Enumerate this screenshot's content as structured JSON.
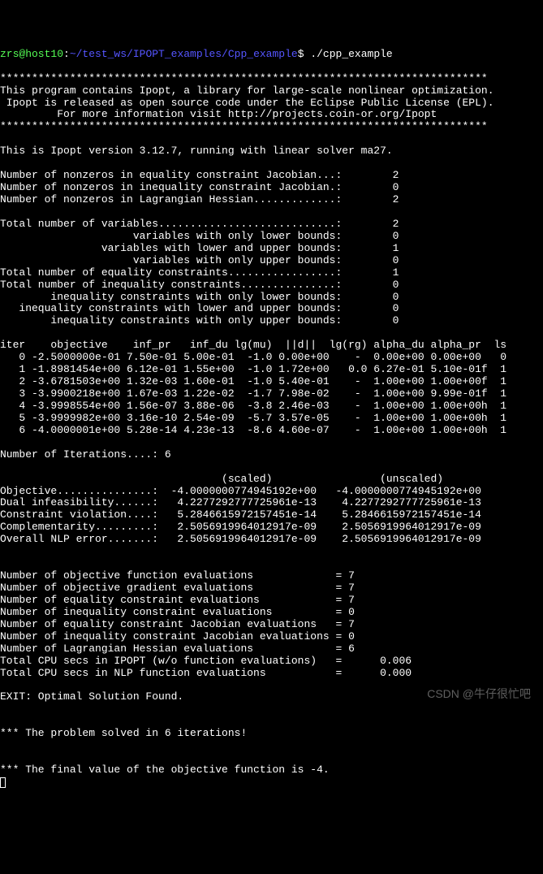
{
  "prompt": {
    "user": "zrs@host10",
    "path": "~/test_ws/IPOPT_examples/Cpp_example",
    "dollar": "$",
    "command": "./cpp_example"
  },
  "header": {
    "stars1": "*****************************************************************************",
    "line1": "This program contains Ipopt, a library for large-scale nonlinear optimization.",
    "line2": " Ipopt is released as open source code under the Eclipse Public License (EPL).",
    "line3": "         For more information visit http://projects.coin-or.org/Ipopt",
    "stars2": "*****************************************************************************"
  },
  "version": "This is Ipopt version 3.12.7, running with linear solver ma27.",
  "section1": {
    "l1": "Number of nonzeros in equality constraint Jacobian...:        2",
    "l2": "Number of nonzeros in inequality constraint Jacobian.:        0",
    "l3": "Number of nonzeros in Lagrangian Hessian.............:        2"
  },
  "section2": {
    "l1": "Total number of variables............................:        2",
    "l2": "                     variables with only lower bounds:        0",
    "l3": "                variables with lower and upper bounds:        1",
    "l4": "                     variables with only upper bounds:        0",
    "l5": "Total number of equality constraints.................:        1",
    "l6": "Total number of inequality constraints...............:        0",
    "l7": "        inequality constraints with only lower bounds:        0",
    "l8": "   inequality constraints with lower and upper bounds:        0",
    "l9": "        inequality constraints with only upper bounds:        0"
  },
  "iterheader": "iter    objective    inf_pr   inf_du lg(mu)  ||d||  lg(rg) alpha_du alpha_pr  ls",
  "iters": {
    "r0": "   0 -2.5000000e-01 7.50e-01 5.00e-01  -1.0 0.00e+00    -  0.00e+00 0.00e+00   0",
    "r1": "   1 -1.8981454e+00 6.12e-01 1.55e+00  -1.0 1.72e+00   0.0 6.27e-01 5.10e-01f  1",
    "r2": "   2 -3.6781503e+00 1.32e-03 1.60e-01  -1.0 5.40e-01    -  1.00e+00 1.00e+00f  1",
    "r3": "   3 -3.9900218e+00 1.67e-03 1.22e-02  -1.7 7.98e-02    -  1.00e+00 9.99e-01f  1",
    "r4": "   4 -3.9998554e+00 1.56e-07 3.88e-06  -3.8 2.46e-03    -  1.00e+00 1.00e+00h  1",
    "r5": "   5 -3.9999982e+00 3.16e-10 2.54e-09  -5.7 3.57e-05    -  1.00e+00 1.00e+00h  1",
    "r6": "   6 -4.0000001e+00 5.28e-14 4.23e-13  -8.6 4.60e-07    -  1.00e+00 1.00e+00h  1"
  },
  "numiter": "Number of Iterations....: 6",
  "scaledheader": "                                   (scaled)                 (unscaled)",
  "results": {
    "l1": "Objective...............:  -4.0000000774945192e+00   -4.0000000774945192e+00",
    "l2": "Dual infeasibility......:   4.2277292777725961e-13    4.2277292777725961e-13",
    "l3": "Constraint violation....:   5.2846615972157451e-14    5.2846615972157451e-14",
    "l4": "Complementarity.........:   2.5056919964012917e-09    2.5056919964012917e-09",
    "l5": "Overall NLP error.......:   2.5056919964012917e-09    2.5056919964012917e-09"
  },
  "evals": {
    "l1": "Number of objective function evaluations             = 7",
    "l2": "Number of objective gradient evaluations             = 7",
    "l3": "Number of equality constraint evaluations            = 7",
    "l4": "Number of inequality constraint evaluations          = 0",
    "l5": "Number of equality constraint Jacobian evaluations   = 7",
    "l6": "Number of inequality constraint Jacobian evaluations = 0",
    "l7": "Number of Lagrangian Hessian evaluations             = 6",
    "l8": "Total CPU secs in IPOPT (w/o function evaluations)   =      0.006",
    "l9": "Total CPU secs in NLP function evaluations           =      0.000"
  },
  "exit": "EXIT: Optimal Solution Found.",
  "success": "*** The problem solved in 6 iterations!",
  "final": "*** The final value of the objective function is -4.",
  "watermark": "CSDN @牛仔很忙吧"
}
